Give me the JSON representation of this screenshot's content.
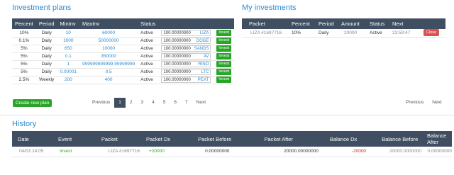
{
  "invest_plans": {
    "title": "Investment plans",
    "headers": [
      "Percent",
      "Period",
      "MinInv",
      "MaxInv",
      "Status"
    ],
    "rows": [
      {
        "percent": "10%",
        "period": "Daily",
        "min": "10",
        "max": "60000",
        "status": "Active",
        "amount": "100.00000000",
        "currency": "LIZA",
        "button": "Invest"
      },
      {
        "percent": "0.1%",
        "period": "Daily",
        "min": "1000",
        "max": "50000000",
        "status": "Active",
        "amount": "100.00000000",
        "currency": "DOGE",
        "button": "Invest"
      },
      {
        "percent": "5%",
        "period": "Daily",
        "min": "650",
        "max": "10000",
        "status": "Active",
        "amount": "100.00000000",
        "currency": "SANDS",
        "button": "Invest"
      },
      {
        "percent": "5%",
        "period": "Daily",
        "min": "0.1",
        "max": "350000",
        "status": "Active",
        "amount": "100.00000000",
        "currency": "AV",
        "button": "Invest"
      },
      {
        "percent": "5%",
        "period": "Daily",
        "min": "1",
        "max": "999999999999.99999999",
        "status": "Active",
        "amount": "100.00000000",
        "currency": "RINO",
        "button": "Invest"
      },
      {
        "percent": "5%",
        "period": "Daily",
        "min": "0.00001",
        "max": "0.5",
        "status": "Active",
        "amount": "100.00000000",
        "currency": "LTC",
        "button": "Invest"
      },
      {
        "percent": "2.5%",
        "period": "Weekly",
        "min": "200",
        "max": "400",
        "status": "Active",
        "amount": "100.00000000",
        "currency": "PEXT",
        "button": "Invest"
      }
    ],
    "create_button": "Create new plan",
    "pager": {
      "prev": "Previous",
      "pages": [
        "1",
        "2",
        "3",
        "4",
        "5",
        "6",
        "7"
      ],
      "next": "Next",
      "active": "1"
    }
  },
  "my_investments": {
    "title": "My investments",
    "headers": [
      "Packet",
      "Percent",
      "Period",
      "Amount",
      "Status",
      "Next"
    ],
    "rows": [
      {
        "packet": "LIZA #1697716",
        "percent": "10%",
        "period": "Daily",
        "amount": "20000",
        "status": "Active",
        "next": "23:59:47",
        "button": "Close"
      }
    ],
    "pager": {
      "prev": "Previous",
      "next": "Next"
    }
  },
  "history": {
    "title": "History",
    "headers": [
      "Date",
      "Event",
      "Packet",
      "Packet Dx",
      "Packet Before",
      "Packet After",
      "Balance Dx",
      "Balance Before",
      "Balance After"
    ],
    "rows": [
      {
        "date": "04/03 14:05",
        "event": "Invest",
        "packet": "LIZA #1697716",
        "packet_dx": "+20000",
        "packet_before": "0.00000000",
        "packet_after": "20000.00000000",
        "balance_dx": "-20000",
        "balance_before": "20000.0000000",
        "balance_after": "0.00000000"
      }
    ]
  },
  "colors": {
    "accent": "#2e8bd0",
    "header_bg": "#3f4e60",
    "invest_green": "#2aa52a",
    "close_red": "#d9534f"
  }
}
